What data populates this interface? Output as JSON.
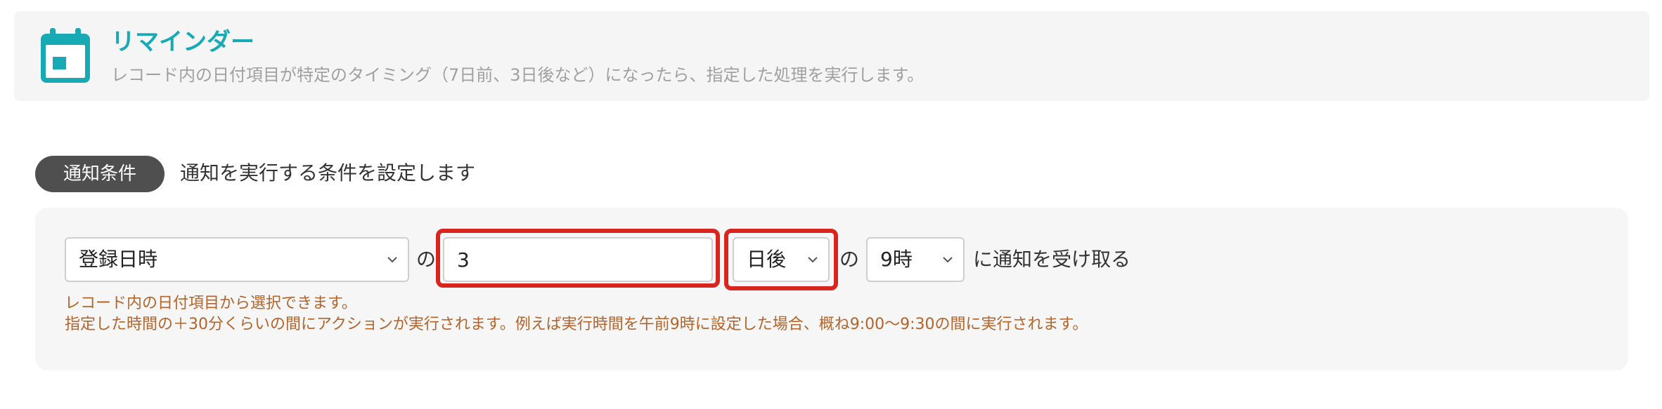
{
  "header": {
    "title": "リマインダー",
    "description": "レコード内の日付項目が特定のタイミング（7日前、3日後など）になったら、指定した処理を実行します。",
    "icon": "calendar-icon",
    "accent_color": "#17a9b4"
  },
  "condition": {
    "badge_label": "通知条件",
    "description": "通知を実行する条件を設定します",
    "date_field": {
      "value": "登録日時",
      "icon": "chevron-down-icon"
    },
    "connector_1": "の",
    "offset_value": "3",
    "direction": {
      "value": "日後",
      "icon": "chevron-down-icon"
    },
    "connector_2": "の",
    "time": {
      "value": "9時",
      "icon": "chevron-down-icon"
    },
    "suffix": "に通知を受け取る",
    "help_lines": [
      "レコード内の日付項目から選択できます。",
      "指定した時間の＋30分くらいの間にアクションが実行されます。例えば実行時間を午前9時に設定した場合、概ね9:00〜9:30の間に実行されます。"
    ],
    "highlight_color": "#d9251d",
    "help_color": "#b3642b"
  }
}
